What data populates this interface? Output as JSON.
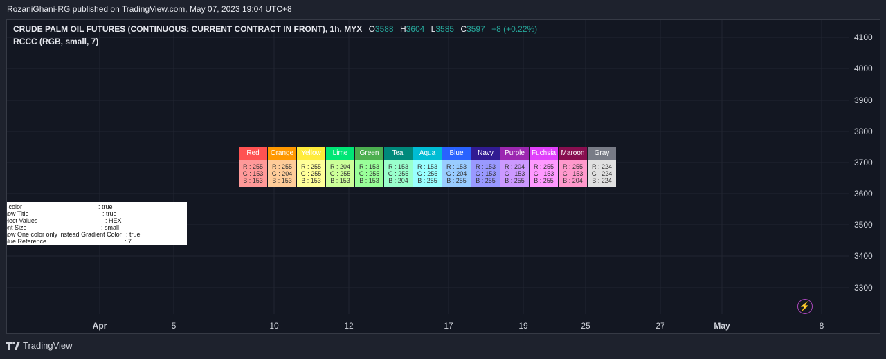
{
  "header": {
    "published": "RozaniGhani-RG published on TradingView.com, May 07, 2023 19:04 UTC+8"
  },
  "legend": {
    "symbol": "CRUDE PALM OIL FUTURES (CONTINUOUS: CURRENT CONTRACT IN FRONT), 1h, MYX",
    "o_label": "O",
    "o_value": "3588",
    "h_label": "H",
    "h_value": "3604",
    "l_label": "L",
    "l_value": "3585",
    "c_label": "C",
    "c_value": "3597",
    "change": "+8 (+0.22%)"
  },
  "indicator": {
    "label": "RCCC (RGB, small, 7)"
  },
  "y_axis": [
    "4100",
    "4000",
    "3900",
    "3800",
    "3700",
    "3600",
    "3500",
    "3400",
    "3300"
  ],
  "x_axis": [
    {
      "label": "Apr",
      "bold": true
    },
    {
      "label": "5",
      "bold": false
    },
    {
      "label": "10",
      "bold": false
    },
    {
      "label": "12",
      "bold": false
    },
    {
      "label": "17",
      "bold": false
    },
    {
      "label": "19",
      "bold": false
    },
    {
      "label": "25",
      "bold": false
    },
    {
      "label": "27",
      "bold": false
    },
    {
      "label": "May",
      "bold": true
    },
    {
      "label": "8",
      "bold": false
    }
  ],
  "color_table": [
    {
      "name": "Red",
      "head": "#ff5252",
      "body": "#ff9999",
      "r": "R : 255",
      "g": "G : 153",
      "b": "B : 153"
    },
    {
      "name": "Orange",
      "head": "#ff9800",
      "body": "#ffcc99",
      "r": "R : 255",
      "g": "G : 204",
      "b": "B : 153"
    },
    {
      "name": "Yellow",
      "head": "#ffeb3b",
      "body": "#ffff99",
      "r": "R : 255",
      "g": "G : 255",
      "b": "B : 153"
    },
    {
      "name": "Lime",
      "head": "#00e676",
      "body": "#ccff99",
      "r": "R : 204",
      "g": "G : 255",
      "b": "B : 153"
    },
    {
      "name": "Green",
      "head": "#4caf50",
      "body": "#99ff99",
      "r": "R : 153",
      "g": "G : 255",
      "b": "B : 153"
    },
    {
      "name": "Teal",
      "head": "#00897b",
      "body": "#99ffcc",
      "r": "R : 153",
      "g": "G : 255",
      "b": "B : 204"
    },
    {
      "name": "Aqua",
      "head": "#00bcd4",
      "body": "#99ffff",
      "r": "R : 153",
      "g": "G : 255",
      "b": "B : 255"
    },
    {
      "name": "Blue",
      "head": "#2962ff",
      "body": "#99ccff",
      "r": "R : 153",
      "g": "G : 204",
      "b": "B : 255"
    },
    {
      "name": "Navy",
      "head": "#311b92",
      "body": "#9999ff",
      "r": "R : 153",
      "g": "G : 153",
      "b": "B : 255"
    },
    {
      "name": "Purple",
      "head": "#9c27b0",
      "body": "#cc99ff",
      "r": "R : 204",
      "g": "G : 153",
      "b": "B : 255"
    },
    {
      "name": "Fuchsia",
      "head": "#e040fb",
      "body": "#ff99ff",
      "r": "R : 255",
      "g": "G : 153",
      "b": "B : 255"
    },
    {
      "name": "Maroon",
      "head": "#880e4f",
      "body": "#ff99cc",
      "r": "R : 255",
      "g": "G : 153",
      "b": "B : 204"
    },
    {
      "name": "Gray",
      "head": "#787b86",
      "body": "#e0e0e0",
      "r": "R : 224",
      "g": "G : 224",
      "b": "B : 224"
    }
  ],
  "settings_table": [
    {
      "key": "ll color",
      "value": ": true"
    },
    {
      "key": "how Title",
      "value": ": true"
    },
    {
      "key": "elect Values",
      "value": ": HEX"
    },
    {
      "key": "ont Size",
      "value": ": small"
    },
    {
      "key": "how One color only instead Gradient Color",
      "value": ": true"
    },
    {
      "key": "alue Reference",
      "value": ": 7"
    }
  ],
  "footer": {
    "brand": "TradingView"
  },
  "colors": {
    "background": "#131722",
    "up": "#26a69a",
    "accent": "#ab47bc"
  },
  "icons": {
    "alert": "lightning-bolt-icon",
    "logo": "tradingview-logo-icon"
  }
}
